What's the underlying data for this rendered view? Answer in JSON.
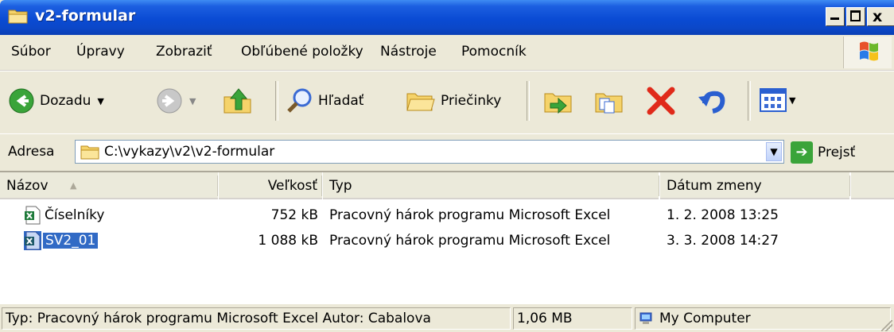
{
  "window": {
    "title": "v2-formular",
    "min_glyph": "_",
    "close_glyph": "x"
  },
  "menu": {
    "items": [
      "Súbor",
      "Úpravy",
      "Zobraziť",
      "Obľúbené položky",
      "Nástroje",
      "Pomocník"
    ]
  },
  "toolbar": {
    "back_label": "Dozadu",
    "search_label": "Hľadať",
    "folders_label": "Priečinky",
    "dropdown_glyph": "▼"
  },
  "address": {
    "label": "Adresa",
    "value": "C:\\vykazy\\v2\\v2-formular",
    "go_label": "Prejsť"
  },
  "columns": {
    "name": "Názov",
    "sort_glyph": "▲",
    "size": "Veľkosť",
    "type": "Typ",
    "date": "Dátum zmeny"
  },
  "files": [
    {
      "name": "Číselníky",
      "size": "752 kB",
      "type": "Pracovný hárok programu Microsoft Excel",
      "date": "1. 2. 2008 13:25",
      "icon": "excel-file-icon",
      "selected": false
    },
    {
      "name": "SV2_01",
      "size": "1 088 kB",
      "type": "Pracovný hárok programu Microsoft Excel",
      "date": "3. 3. 2008 14:27",
      "icon": "excel-file-icon",
      "selected": true
    }
  ],
  "status": {
    "info": "Typ: Pracovný hárok programu Microsoft Excel Autor: Cabalova",
    "size": "1,06 MB",
    "location": "My Computer"
  },
  "colors": {
    "titlebar": "#0a4bd4",
    "selection": "#316ac5",
    "chrome": "#ece9d8"
  }
}
